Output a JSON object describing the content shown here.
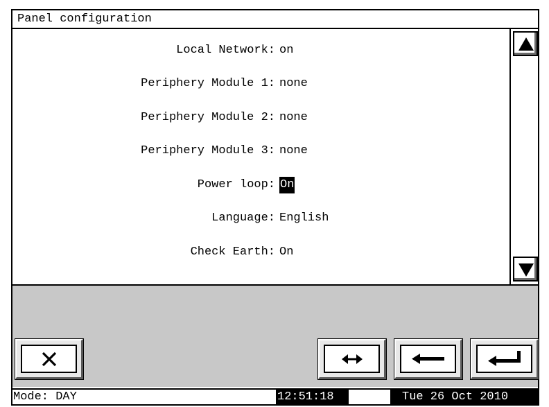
{
  "window": {
    "title": "Panel configuration"
  },
  "settings": [
    {
      "label": "Local Network:",
      "value": "on",
      "selected": false
    },
    {
      "label": "Periphery Module 1:",
      "value": "none",
      "selected": false
    },
    {
      "label": "Periphery Module 2:",
      "value": "none",
      "selected": false
    },
    {
      "label": "Periphery Module 3:",
      "value": "none",
      "selected": false
    },
    {
      "label": "Power loop:",
      "value": "On",
      "selected": true
    },
    {
      "label": "Language:",
      "value": "English",
      "selected": false
    },
    {
      "label": "Check Earth:",
      "value": "On",
      "selected": false
    }
  ],
  "scrollbar": {
    "up_icon": "triangle-up-icon",
    "down_icon": "triangle-down-icon"
  },
  "buttons": {
    "cancel_icon": "x-icon",
    "swap_icon": "left-right-arrow-icon",
    "back_icon": "left-arrow-icon",
    "enter_icon": "enter-return-icon"
  },
  "status": {
    "mode": "Mode: DAY",
    "time": "12:51:18",
    "date": "Tue 26 Oct 2010"
  },
  "colors": {
    "background": "#ffffff",
    "button_area": "#c8c8c8",
    "highlight": "#000000"
  }
}
